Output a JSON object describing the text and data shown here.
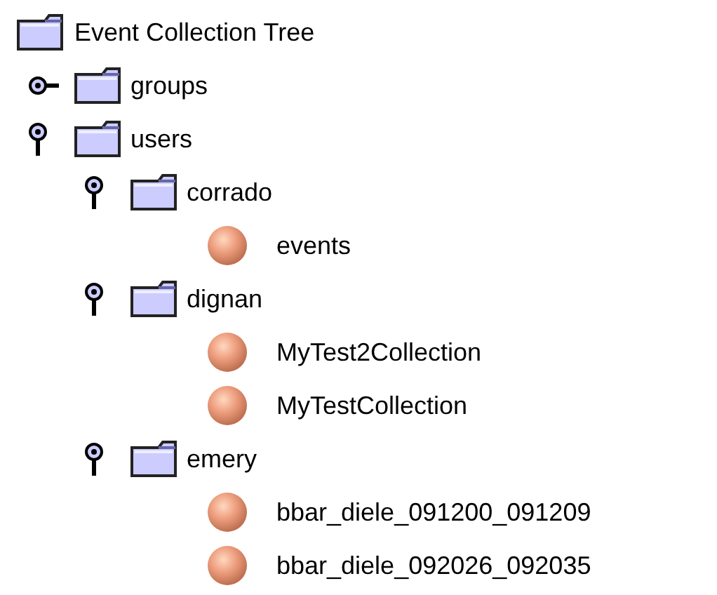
{
  "tree": {
    "label": "Event Collection Tree",
    "children": [
      {
        "kind": "folder",
        "label": "groups",
        "expanded": false
      },
      {
        "kind": "folder",
        "label": "users",
        "expanded": true,
        "children": [
          {
            "kind": "folder",
            "label": "corrado",
            "expanded": true,
            "children": [
              {
                "kind": "leaf",
                "label": "events"
              }
            ]
          },
          {
            "kind": "folder",
            "label": "dignan",
            "expanded": true,
            "children": [
              {
                "kind": "leaf",
                "label": "MyTest2Collection"
              },
              {
                "kind": "leaf",
                "label": "MyTestCollection"
              }
            ]
          },
          {
            "kind": "folder",
            "label": "emery",
            "expanded": true,
            "children": [
              {
                "kind": "leaf",
                "label": "bbar_diele_091200_091209"
              },
              {
                "kind": "leaf",
                "label": "bbar_diele_092026_092035"
              }
            ]
          }
        ]
      }
    ]
  }
}
